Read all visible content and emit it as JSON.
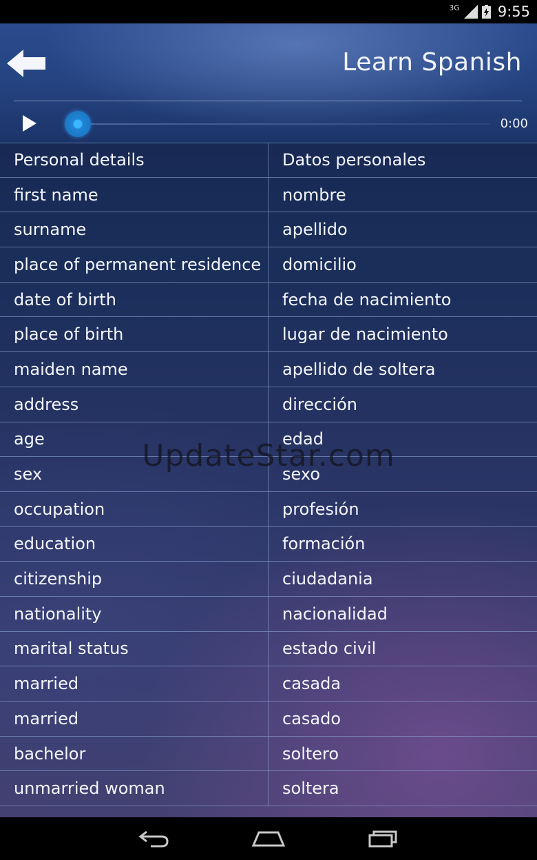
{
  "status_bar": {
    "network": "3G",
    "time": "9:55"
  },
  "header": {
    "title": "Learn Spanish"
  },
  "player": {
    "time": "0:00"
  },
  "table": {
    "rows": [
      [
        "Personal details",
        "Datos personales"
      ],
      [
        "first name",
        "nombre"
      ],
      [
        "surname",
        "apellido"
      ],
      [
        "place of permanent residence",
        "domicilio"
      ],
      [
        "date of birth",
        "fecha de nacimiento"
      ],
      [
        "place of birth",
        "lugar de nacimiento"
      ],
      [
        "maiden name",
        "apellido de soltera"
      ],
      [
        "address",
        "dirección"
      ],
      [
        "age",
        "edad"
      ],
      [
        "sex",
        "sexo"
      ],
      [
        "occupation",
        "profesión"
      ],
      [
        "education",
        "formación"
      ],
      [
        "citizenship",
        "ciudadania"
      ],
      [
        "nationality",
        "nacionalidad"
      ],
      [
        "marital status",
        "estado civil"
      ],
      [
        "married",
        "casada"
      ],
      [
        "married",
        "casado"
      ],
      [
        "bachelor",
        "soltero"
      ],
      [
        "unmarried woman",
        "soltera"
      ]
    ]
  },
  "watermark": "UpdateStar.com",
  "icons": {
    "back": "back-arrow-icon",
    "play": "play-icon",
    "nav_back": "nav-back-icon",
    "nav_home": "nav-home-icon",
    "nav_recents": "nav-recents-icon"
  },
  "colors": {
    "header": "#24427f",
    "seek_thumb": "#3ab6ff"
  }
}
